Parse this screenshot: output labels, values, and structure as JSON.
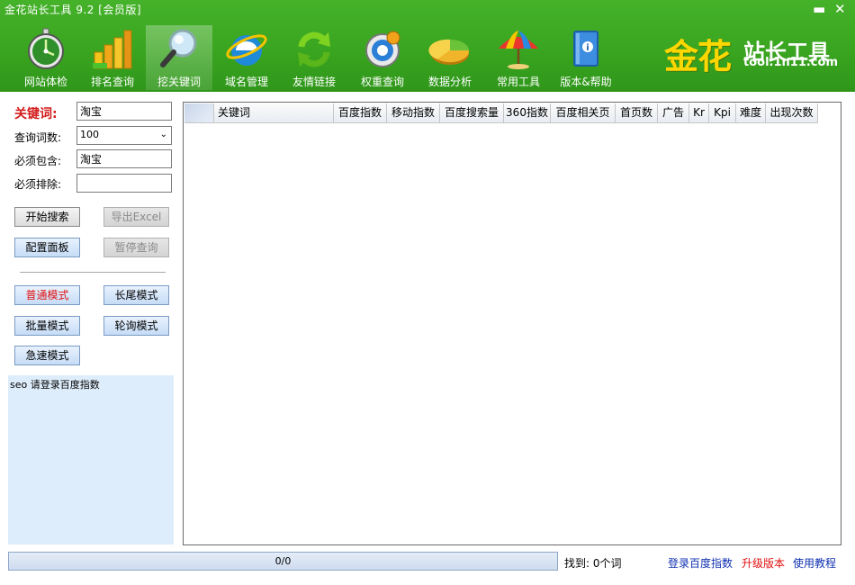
{
  "window": {
    "title": "金花站长工具 9.2 [会员版]",
    "minimize_glyph": "▬",
    "close_glyph": "✕"
  },
  "toolbar": {
    "items": [
      {
        "label": "网站体检",
        "icon": "stopwatch-icon"
      },
      {
        "label": "排名查询",
        "icon": "bar-chart-icon"
      },
      {
        "label": "挖关键词",
        "icon": "magnifier-icon",
        "active": true
      },
      {
        "label": "域名管理",
        "icon": "ie-icon"
      },
      {
        "label": "友情链接",
        "icon": "refresh-arrows-icon"
      },
      {
        "label": "权重查询",
        "icon": "target-icon"
      },
      {
        "label": "数据分析",
        "icon": "pie-chart-icon"
      },
      {
        "label": "常用工具",
        "icon": "umbrella-icon"
      },
      {
        "label": "版本&帮助",
        "icon": "book-icon"
      }
    ]
  },
  "logo": {
    "main": "金花",
    "sub": "站长工具",
    "url": "tool.1n11.com"
  },
  "form": {
    "keyword_label": "关键词:",
    "keyword_value": "淘宝",
    "count_label": "查询词数:",
    "count_value": "100",
    "include_label": "必须包含:",
    "include_value": "淘宝",
    "exclude_label": "必须排除:",
    "exclude_value": ""
  },
  "buttons": {
    "start": "开始搜索",
    "export": "导出Excel",
    "config": "配置面板",
    "pause": "暂停查询",
    "normal_mode": "普通模式",
    "longtail_mode": "长尾模式",
    "batch_mode": "批量模式",
    "poll_mode": "轮询模式",
    "fast_mode": "急速模式"
  },
  "log": {
    "text": "seo 请登录百度指数"
  },
  "table": {
    "columns": [
      "",
      "关键词",
      "百度指数",
      "移动指数",
      "百度搜索量",
      "360指数",
      "百度相关页",
      "首页数",
      "广告",
      "Kr",
      "Kpi",
      "难度",
      "出现次数"
    ],
    "rows": []
  },
  "status": {
    "progress_text": "0/0",
    "progress": 0,
    "found_text": "找到: 0个词",
    "login_link": "登录百度指数",
    "upgrade_link": "升级版本",
    "tutorial_link": "使用教程"
  },
  "colors": {
    "header_green": "#3aa520",
    "keyword_red": "#d41c1c",
    "link_blue": "#1030b0",
    "link_red": "#e01010",
    "log_bg": "#deedfb"
  }
}
